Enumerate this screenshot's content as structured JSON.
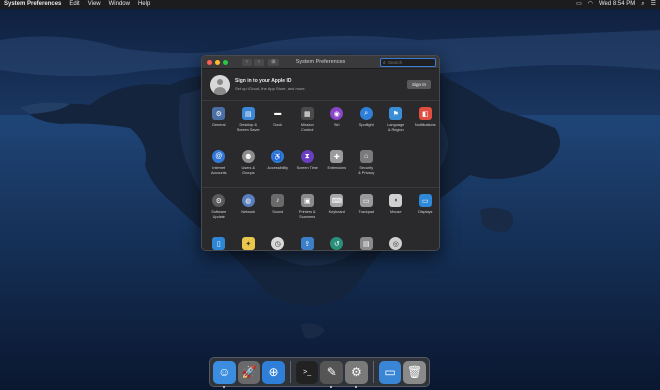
{
  "menubar": {
    "app_name": "System Preferences",
    "menus": [
      "Edit",
      "View",
      "Window",
      "Help"
    ],
    "clock": "Wed 8:54 PM",
    "icons": [
      "airplay-icon",
      "wifi-icon",
      "search-icon",
      "menu-list-icon"
    ]
  },
  "window": {
    "title": "System Preferences",
    "search_placeholder": "Search",
    "account": {
      "title": "Sign in to your Apple ID",
      "subtitle": "Set up iCloud, the App Store, and more.",
      "button": "Sign In"
    },
    "sections": [
      [
        {
          "label": "General",
          "icon": "general-icon",
          "color": "#4a6fa5"
        },
        {
          "label": "Desktop &\nScreen Saver",
          "icon": "desktop-icon",
          "color": "#3c86d6"
        },
        {
          "label": "Dock",
          "icon": "dock-icon",
          "color": "#2b2b2b"
        },
        {
          "label": "Mission\nControl",
          "icon": "mission-control-icon",
          "color": "#4b4b4b"
        },
        {
          "label": "Siri",
          "icon": "siri-icon",
          "color": "#8a45c9"
        },
        {
          "label": "Spotlight",
          "icon": "spotlight-icon",
          "color": "#2f7fd8"
        },
        {
          "label": "Language\n& Region",
          "icon": "language-icon",
          "color": "#3a8ed8"
        },
        {
          "label": "Notifications",
          "icon": "notifications-icon",
          "color": "#e04e40"
        }
      ],
      [
        {
          "label": "Internet\nAccounts",
          "icon": "internet-accounts-icon",
          "color": "#3478d6"
        },
        {
          "label": "Users &\nGroups",
          "icon": "users-icon",
          "color": "#8d8d8d"
        },
        {
          "label": "Accessibility",
          "icon": "accessibility-icon",
          "color": "#2f7ed8"
        },
        {
          "label": "Screen Time",
          "icon": "screen-time-icon",
          "color": "#6a3fbf"
        },
        {
          "label": "Extensions",
          "icon": "extensions-icon",
          "color": "#9a9a9a"
        },
        {
          "label": "Security\n& Privacy",
          "icon": "security-icon",
          "color": "#7a7a7a"
        }
      ],
      [
        {
          "label": "Software\nUpdate",
          "icon": "software-update-icon",
          "color": "#5a5a5c"
        },
        {
          "label": "Network",
          "icon": "network-icon",
          "color": "#5a7fbf"
        },
        {
          "label": "Sound",
          "icon": "sound-icon",
          "color": "#6a6a6a"
        },
        {
          "label": "Printers &\nScanners",
          "icon": "printer-icon",
          "color": "#8a8a8a"
        },
        {
          "label": "Keyboard",
          "icon": "keyboard-icon",
          "color": "#a8a8a8"
        },
        {
          "label": "Trackpad",
          "icon": "trackpad-icon",
          "color": "#9a9a9a"
        },
        {
          "label": "Mouse",
          "icon": "mouse-icon",
          "color": "#d0d0d0"
        },
        {
          "label": "Displays",
          "icon": "displays-icon",
          "color": "#2e8ad8"
        }
      ],
      [
        {
          "label": "Sidecar",
          "icon": "sidecar-icon",
          "color": "#2e86d6"
        },
        {
          "label": "Energy\nSaver",
          "icon": "energy-saver-icon",
          "color": "#e8c74a"
        },
        {
          "label": "Date & Time",
          "icon": "date-time-icon",
          "color": "#d8d8d8"
        },
        {
          "label": "Sharing",
          "icon": "sharing-icon",
          "color": "#3a7fc8"
        },
        {
          "label": "Time\nMachine",
          "icon": "time-machine-icon",
          "color": "#2a8f7a"
        },
        {
          "label": "Startup\nDisk",
          "icon": "startup-disk-icon",
          "color": "#8a8a8a"
        },
        {
          "label": "CDs & DVDs",
          "icon": "cd-icon",
          "color": "#cfcfcf"
        }
      ]
    ]
  },
  "dock": [
    {
      "name": "finder-icon",
      "color": "#3b8de0",
      "glyph": "☺"
    },
    {
      "name": "launchpad-icon",
      "color": "#6a6a6c",
      "glyph": "🚀"
    },
    {
      "name": "safari-icon",
      "color": "#2f7fd8",
      "glyph": "⊕"
    },
    {
      "name": "separator"
    },
    {
      "name": "terminal-icon",
      "color": "#222",
      "glyph": ">_"
    },
    {
      "name": "script-editor-icon",
      "color": "#555",
      "glyph": "✎"
    },
    {
      "name": "system-preferences-icon",
      "color": "#7a7a7a",
      "glyph": "⚙"
    },
    {
      "name": "separator"
    },
    {
      "name": "downloads-folder-icon",
      "color": "#3a86d6",
      "glyph": "▭"
    },
    {
      "name": "trash-icon",
      "color": "#8a8a8a",
      "glyph": "🗑"
    }
  ]
}
